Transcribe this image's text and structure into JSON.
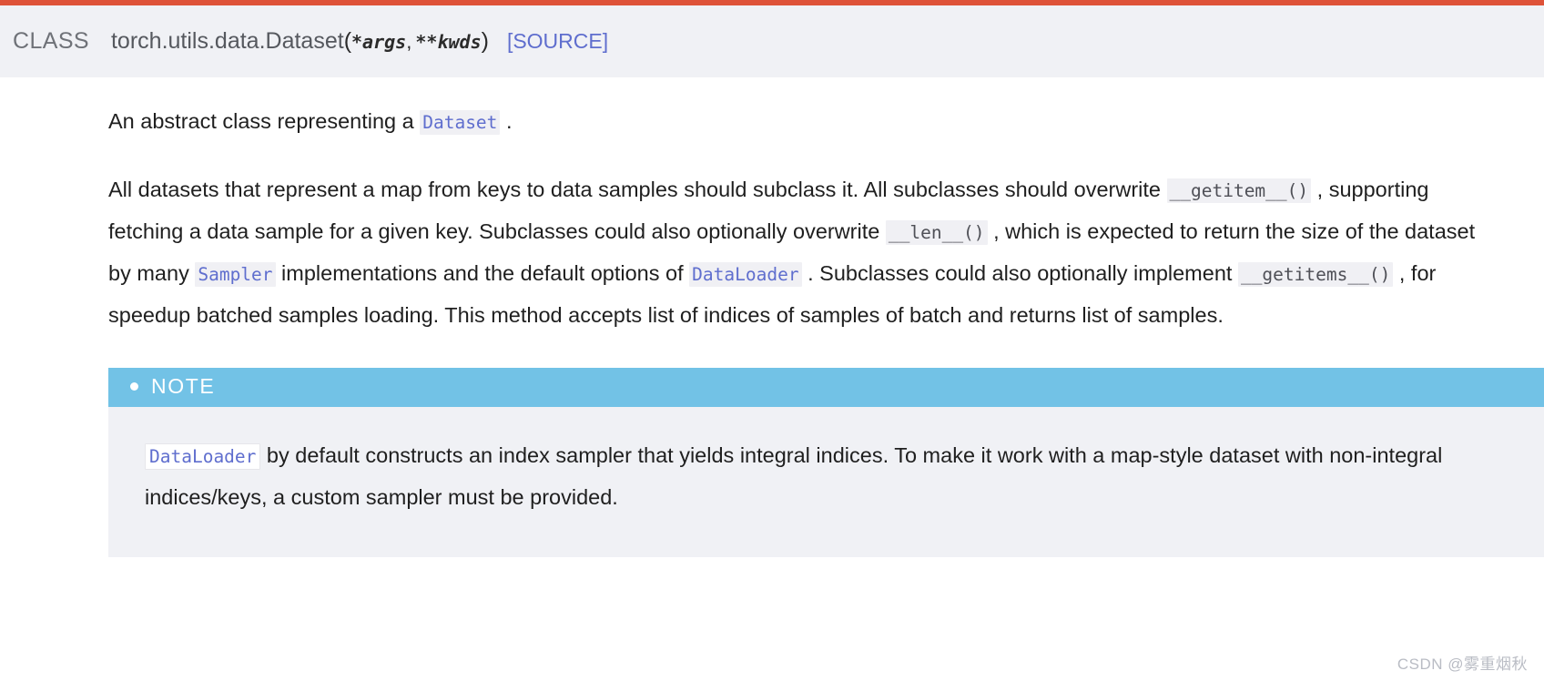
{
  "theme": {
    "accent_bar_color": "#de5238",
    "header_bg": "#f0f1f5",
    "link_color": "#5f6ece",
    "note_header_bg": "#72c2e6",
    "note_body_bg": "#f0f1f5",
    "code_bg": "#f0f0f4"
  },
  "signature": {
    "keyword": "CLASS",
    "qualified_name": "torch.utils.data.Dataset",
    "open_paren": "(",
    "param1": "*args",
    "param_separator": ",",
    "param2": "**kwds",
    "close_paren": ")",
    "source_link": "[SOURCE]"
  },
  "paragraphs": {
    "p1": {
      "text_before": "An abstract class representing a ",
      "code": "Dataset",
      "text_after": " ."
    },
    "p2": {
      "seg1": "All datasets that represent a map from keys to data samples should subclass it. All subclasses should overwrite ",
      "code1": "__getitem__()",
      "seg2": " , supporting fetching a data sample for a given key. Subclasses could also optionally overwrite ",
      "code2": "__len__()",
      "seg3": " , which is expected to return the size of the dataset by many ",
      "code3": "Sampler",
      "seg4": " implementations and the default options of ",
      "code4": "DataLoader",
      "seg5": " . Subclasses could also optionally implement ",
      "code5": "__getitems__()",
      "seg6": " , for speedup batched samples loading. This method accepts list of indices of samples of batch and returns list of samples."
    }
  },
  "note": {
    "title": "NOTE",
    "bullet": "bullet-icon",
    "body": {
      "code": "DataLoader",
      "text": " by default constructs an index sampler that yields integral indices. To make it work with a map-style dataset with non-integral indices/keys, a custom sampler must be provided."
    }
  },
  "watermark": {
    "text": "CSDN @雾重烟秋"
  }
}
